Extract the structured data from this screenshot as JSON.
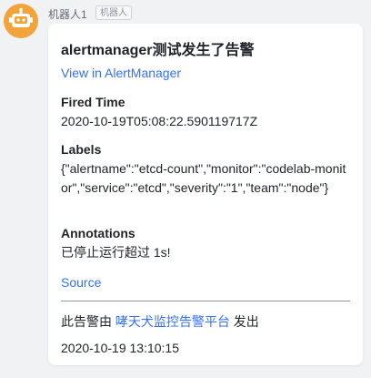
{
  "sender": {
    "name": "机器人1",
    "badge": "机器人"
  },
  "card": {
    "title": "alertmanager测试发生了告警",
    "view_link": "View in AlertManager",
    "fired_time_label": "Fired Time",
    "fired_time_value": "2020-10-19T05:08:22.590119717Z",
    "labels_label": "Labels",
    "labels_value": "{\"alertname\":\"etcd-count\",\"monitor\":\"codelab-monitor\",\"service\":\"etcd\",\"severity\":\"1\",\"team\":\"node\"}",
    "annotations_label": "Annotations",
    "annotations_value": "已停止运行超过 1s!",
    "source_link": "Source",
    "footer_prefix": "此告警由",
    "footer_platform": "哮天犬监控告警平台",
    "footer_suffix": "发出",
    "timestamp": "2020-10-19 13:10:15"
  },
  "colors": {
    "link": "#3370ff",
    "avatar": "#f2a33a",
    "background": "#f1f2f4"
  }
}
